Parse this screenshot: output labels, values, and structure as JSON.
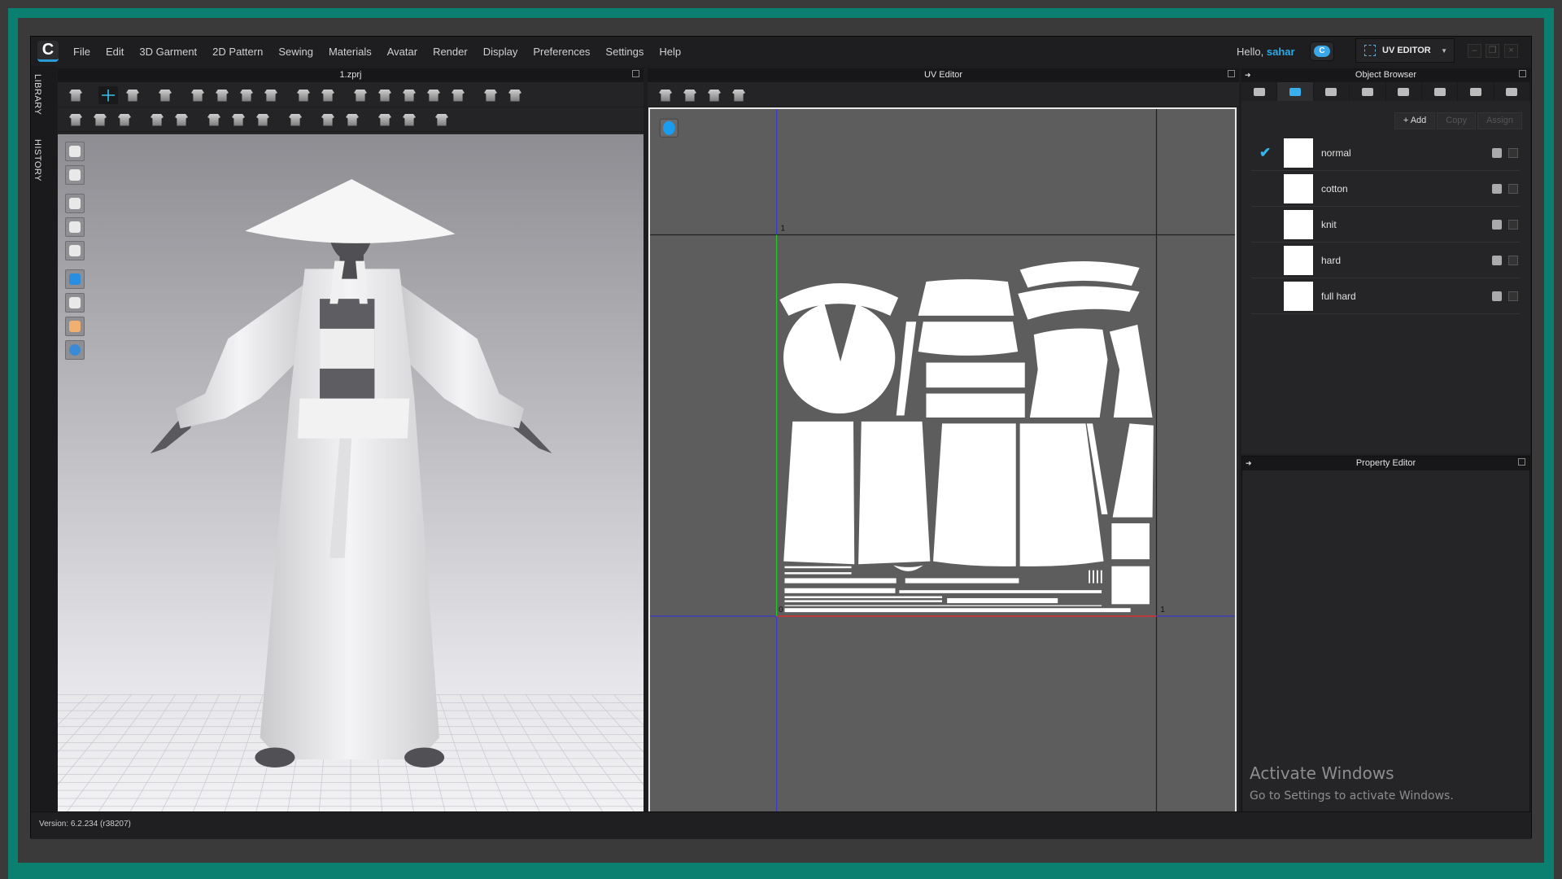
{
  "app": {
    "logo_letter": "C",
    "version": "Version: 6.2.234 (r38207)"
  },
  "menu": [
    "File",
    "Edit",
    "3D Garment",
    "2D Pattern",
    "Sewing",
    "Materials",
    "Avatar",
    "Render",
    "Display",
    "Preferences",
    "Settings",
    "Help"
  ],
  "user": {
    "greeting": "Hello,",
    "name": "sahar"
  },
  "mode_selector": {
    "label": "UV EDITOR"
  },
  "window_controls": {
    "minimize": "–",
    "restore": "❐",
    "close": "×"
  },
  "side_tabs": [
    "LIBRARY",
    "HISTORY"
  ],
  "viewport_3d": {
    "title": "1.zprj",
    "toolbar_row1": [
      "simulation-icon",
      "select-move-icon",
      "edit-curvature-icon",
      "garment-select-icon",
      "fold-arrangement-icon",
      "tack-icon",
      "tack-line-icon",
      "fold-tack-icon",
      "pin-icon",
      "cut-icon",
      "shrink-icon",
      "strengthen-icon",
      "fit-icon",
      "avatar-measure-icon",
      "avatar-pose-icon",
      "garment-measure-icon",
      "garment-length-icon"
    ],
    "toolbar_row1_groups": [
      0,
      1,
      3,
      4,
      8,
      10,
      15
    ],
    "toolbar_row2": [
      "edit-pattern-icon",
      "seam-tape-icon",
      "seam-line-icon",
      "edit-trim-icon",
      "select-button-icon",
      "buttonhole-icon",
      "button-icon",
      "button-add-icon",
      "zipper-icon",
      "select-tape-icon",
      "tape-icon",
      "select-puckering-icon",
      "puckering-icon",
      "stitch-icon"
    ],
    "toolbar_row2_groups": [
      0,
      3,
      5,
      8,
      9,
      11,
      13
    ],
    "side_icons": [
      "3d-pen-icon",
      "garment-icon",
      "show-garment-icon",
      "show-avatar-pins-icon",
      "show-avatar-icon",
      "fabric-texture-icon",
      "shading-icon",
      "avatar-skin-icon",
      "global-view-icon"
    ]
  },
  "uv_editor": {
    "title": "UV Editor",
    "toolbar": [
      "capture-uv-icon",
      "capture-pattern-icon",
      "move-uv-icon",
      "arrange-uv-icon"
    ],
    "axis_labels": {
      "top": "1",
      "origin": "0",
      "right": "1"
    }
  },
  "object_browser": {
    "title": "Object Browser",
    "tabs": [
      "list-icon",
      "fabric-icon",
      "button-icon",
      "line-icon",
      "topstitch-icon",
      "zigzag-icon",
      "pieces-icon",
      "ruler-icon"
    ],
    "active_tab": 1,
    "buttons": {
      "add": "+ Add",
      "copy": "Copy",
      "assign": "Assign"
    },
    "materials": [
      {
        "name": "normal",
        "selected": true
      },
      {
        "name": "cotton",
        "selected": false
      },
      {
        "name": "knit",
        "selected": false
      },
      {
        "name": "hard",
        "selected": false
      },
      {
        "name": "full hard",
        "selected": false
      }
    ],
    "check_glyph": "✔"
  },
  "property_editor": {
    "title": "Property Editor"
  },
  "watermark": {
    "line1": "Activate Windows",
    "line2": "Go to Settings to activate Windows."
  },
  "colors": {
    "accent": "#2ea8e6",
    "frame": "#0b8070",
    "uv_bg": "#5d5d5d"
  }
}
